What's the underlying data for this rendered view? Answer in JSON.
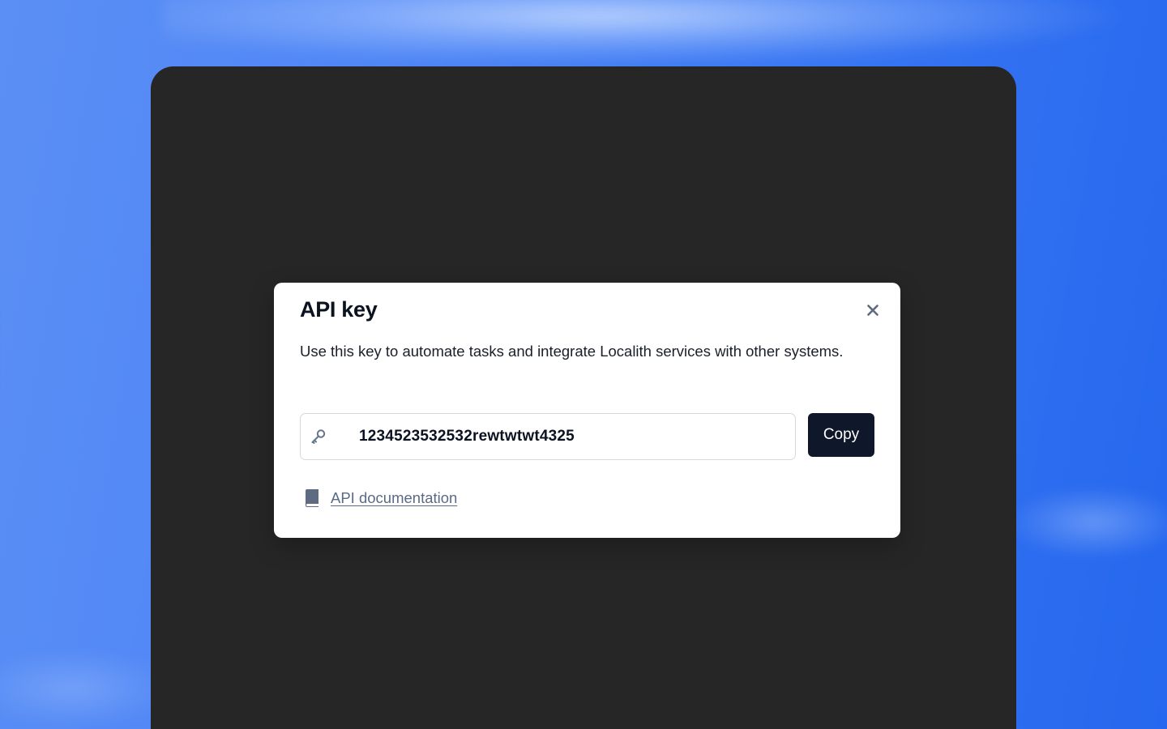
{
  "dialog": {
    "title": "API key",
    "description": "Use this key to automate tasks and integrate Localith services with other systems.",
    "close_icon": "close-icon",
    "api_key": {
      "icon": "key-icon",
      "value": "1234523532532rewtwtwt4325"
    },
    "copy_label": "Copy",
    "doc_link": {
      "icon": "book-icon",
      "label": "API documentation"
    }
  },
  "colors": {
    "background_gradient": [
      "#5b8ff5",
      "#2567ee"
    ],
    "app_window": "#262626",
    "modal_bg": "#ffffff",
    "title_text": "#0b1220",
    "copy_button_bg": "#0f172a",
    "link_text": "#5a6a85",
    "icon_gray": "#64748b"
  }
}
